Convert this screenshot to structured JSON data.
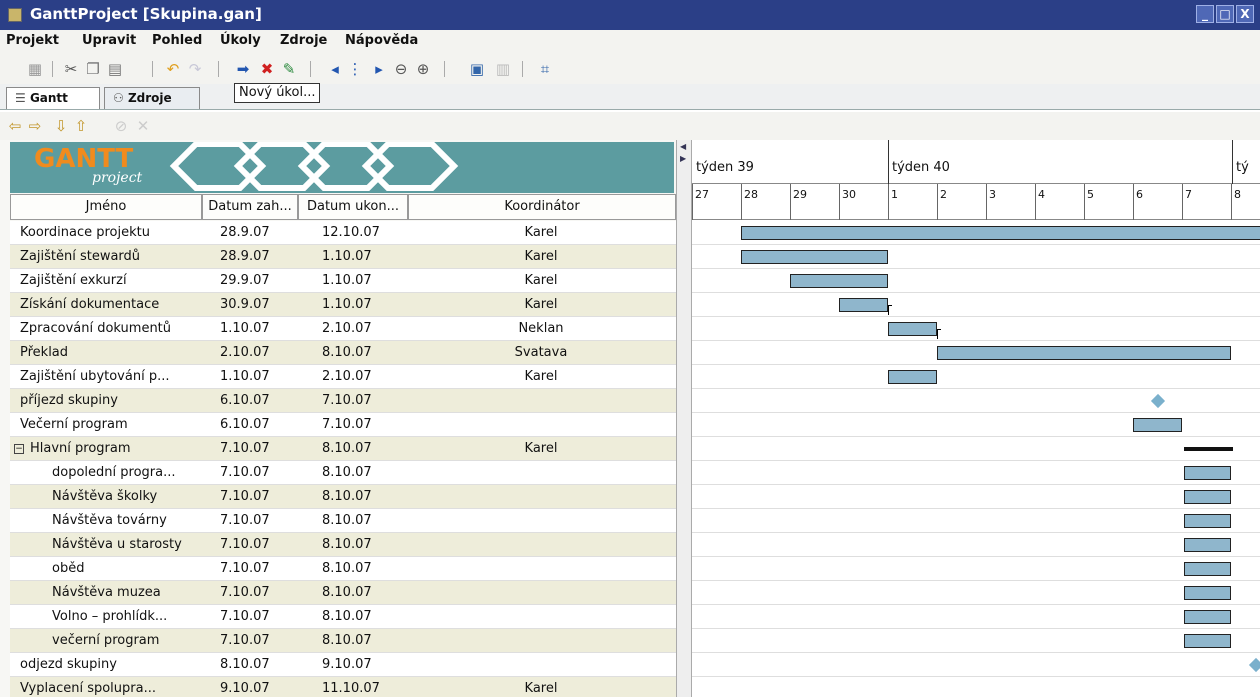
{
  "window": {
    "title": "GanttProject [Skupina.gan]"
  },
  "menu": [
    "Projekt",
    "Upravit",
    "Pohled",
    "Úkoly",
    "Zdroje",
    "Nápověda"
  ],
  "tabs": {
    "gantt": "Gantt",
    "resources": "Zdroje"
  },
  "tooltip": "Nový úkol...",
  "logo": {
    "word": "GANTT",
    "sub": "project"
  },
  "columns": {
    "name": "Jméno",
    "start": "Datum zah...",
    "end": "Datum ukon...",
    "coordinator": "Koordinátor"
  },
  "tasks": [
    {
      "name": "Koordinace projektu",
      "start": "28.9.07",
      "end": "12.10.07",
      "coordinator": "Karel"
    },
    {
      "name": "Zajištění stewardů",
      "start": "28.9.07",
      "end": "1.10.07",
      "coordinator": "Karel"
    },
    {
      "name": "Zajištění exkurzí",
      "start": "29.9.07",
      "end": "1.10.07",
      "coordinator": "Karel"
    },
    {
      "name": "Získání dokumentace",
      "start": "30.9.07",
      "end": "1.10.07",
      "coordinator": "Karel"
    },
    {
      "name": "Zpracování dokumentů",
      "start": "1.10.07",
      "end": "2.10.07",
      "coordinator": "Neklan"
    },
    {
      "name": "Překlad",
      "start": "2.10.07",
      "end": "8.10.07",
      "coordinator": "Svatava"
    },
    {
      "name": "Zajištění ubytování p...",
      "start": "1.10.07",
      "end": "2.10.07",
      "coordinator": "Karel"
    },
    {
      "name": "příjezd skupiny",
      "start": "6.10.07",
      "end": "7.10.07",
      "coordinator": ""
    },
    {
      "name": "Večerní program",
      "start": "6.10.07",
      "end": "7.10.07",
      "coordinator": ""
    },
    {
      "name": "Hlavní program",
      "start": "7.10.07",
      "end": "8.10.07",
      "coordinator": "Karel"
    },
    {
      "name": "dopolední progra...",
      "start": "7.10.07",
      "end": "8.10.07",
      "coordinator": ""
    },
    {
      "name": "Návštěva školky",
      "start": "7.10.07",
      "end": "8.10.07",
      "coordinator": ""
    },
    {
      "name": "Návštěva továrny",
      "start": "7.10.07",
      "end": "8.10.07",
      "coordinator": ""
    },
    {
      "name": "Návštěva u starosty",
      "start": "7.10.07",
      "end": "8.10.07",
      "coordinator": ""
    },
    {
      "name": "oběd",
      "start": "7.10.07",
      "end": "8.10.07",
      "coordinator": ""
    },
    {
      "name": "Návštěva muzea",
      "start": "7.10.07",
      "end": "8.10.07",
      "coordinator": ""
    },
    {
      "name": "Volno – prohlídk...",
      "start": "7.10.07",
      "end": "8.10.07",
      "coordinator": ""
    },
    {
      "name": "večerní program",
      "start": "7.10.07",
      "end": "8.10.07",
      "coordinator": ""
    },
    {
      "name": "odjezd skupiny",
      "start": "8.10.07",
      "end": "9.10.07",
      "coordinator": ""
    },
    {
      "name": "Vyplacení spolupra...",
      "start": "9.10.07",
      "end": "11.10.07",
      "coordinator": "Karel"
    }
  ],
  "timeline": {
    "weeks": [
      "týden 39",
      "týden 40",
      "tý"
    ],
    "days": [
      "27",
      "28",
      "29",
      "30",
      "1",
      "2",
      "3",
      "4",
      "5",
      "6",
      "7",
      "8"
    ]
  }
}
